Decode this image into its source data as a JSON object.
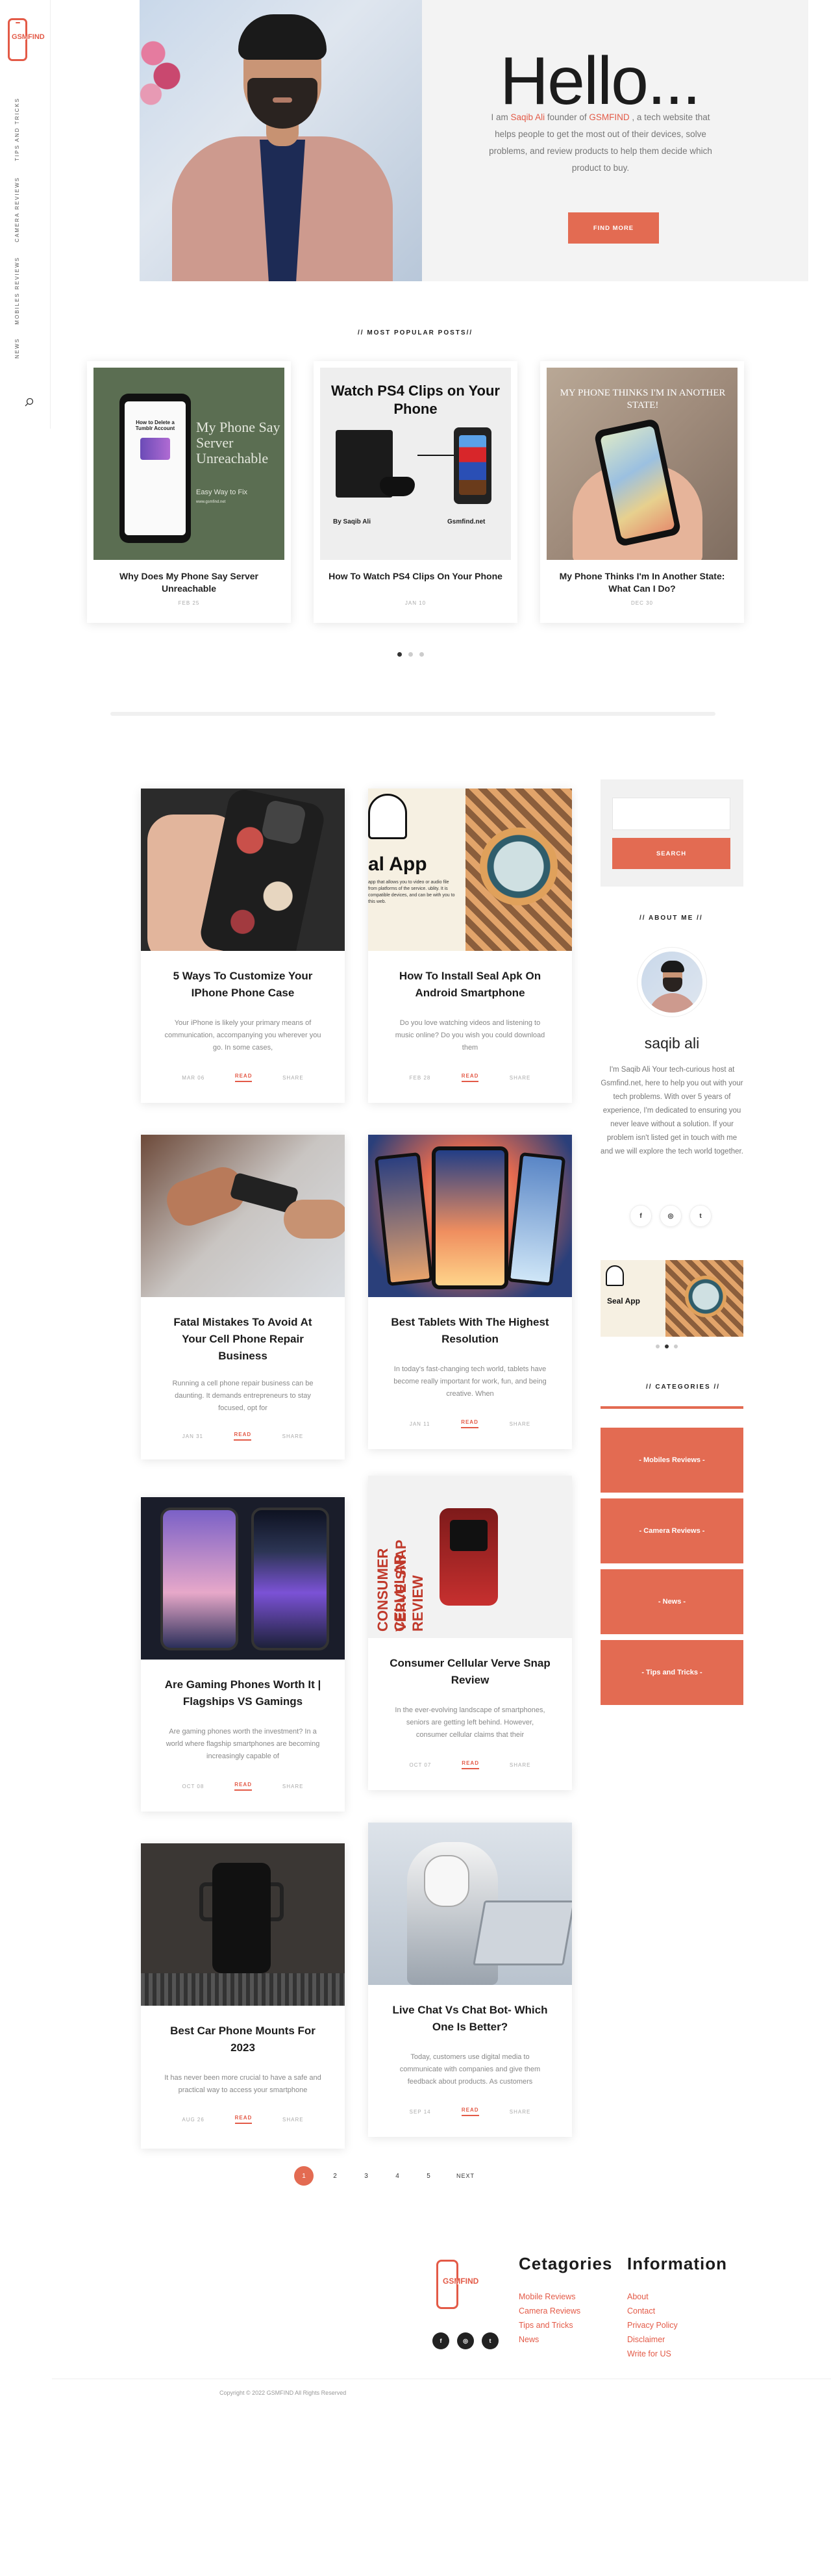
{
  "logo": {
    "text": "GSMFIND"
  },
  "sidenav": {
    "items": [
      "TIPS AND TRICKS",
      "CAMERA REVIEWS",
      "MOBILES REVIEWS",
      "NEWS"
    ]
  },
  "hero": {
    "title": "Hello...",
    "text_before": "I am ",
    "author": "Saqib Ali",
    "text_mid": " founder of ",
    "site": "GSMFIND",
    "text_after": " , a tech website that helps people to get the most out of their devices, solve problems, and review products to help them decide which product to buy.",
    "button": "FIND MORE"
  },
  "popular": {
    "title": "// MOST POPULAR POSTS//",
    "posts": [
      {
        "title": "Why Does My Phone Say Server Unreachable",
        "date": "FEB 25",
        "img_title": "My Phone Say Server Unreachable",
        "img_sub": "Easy Way to Fix",
        "img_screen": "How to Delete a Tumblr Account",
        "img_url": "www.gsmfind.net"
      },
      {
        "title": "How To Watch PS4 Clips On Your Phone",
        "date": "JAN 10",
        "img_title": "Watch PS4 Clips on Your Phone",
        "img_by": "By Saqib Ali",
        "img_site": "Gsmfind.net"
      },
      {
        "title": "My Phone Thinks I'm In Another State: What Can I Do?",
        "date": "DEC 30",
        "img_title": "MY PHONE THINKS I'M IN ANOTHER STATE!"
      }
    ]
  },
  "posts": [
    {
      "title": "5 Ways To Customize Your IPhone Phone Case",
      "excerpt": "Your iPhone is likely your primary means of communication, accompanying you wherever you go. In some cases,",
      "date": "MAR 06",
      "read": "READ",
      "share": "SHARE"
    },
    {
      "title": "How To Install Seal Apk On Android Smartphone",
      "excerpt": "Do you love watching videos and listening to music online? Do you wish you could download them",
      "date": "FEB 28",
      "read": "READ",
      "share": "SHARE",
      "img_label": "al App",
      "img_small": "app that allows you to video or audio file from platforms of the service. ublity. It is compatible devices, and can be with you to this web."
    },
    {
      "title": "Fatal Mistakes To Avoid At Your Cell Phone Repair Business",
      "excerpt": "Running a cell phone repair business can be daunting. It demands entrepreneurs to stay focused, opt for",
      "date": "JAN 31",
      "read": "READ",
      "share": "SHARE"
    },
    {
      "title": "Best Tablets With The Highest Resolution",
      "excerpt": "In today's fast-changing tech world, tablets have become really important for work, fun, and being creative. When",
      "date": "JAN 11",
      "read": "READ",
      "share": "SHARE"
    },
    {
      "title": "Are Gaming Phones Worth It | Flagships VS Gamings",
      "excerpt": "Are gaming phones worth the investment? In a world where flagship smartphones are becoming increasingly capable of",
      "date": "OCT 08",
      "read": "READ",
      "share": "SHARE"
    },
    {
      "title": "Consumer Cellular Verve Snap Review",
      "excerpt": "In the ever-evolving landscape of smartphones, seniors are getting left behind. However, consumer cellular claims that their",
      "date": "OCT 07",
      "read": "READ",
      "share": "SHARE",
      "img_v1": "CONSUMER CELLULAR",
      "img_v2": "VERVE SNAP REVIEW"
    },
    {
      "title": "Best Car Phone Mounts For 2023",
      "excerpt": "It has never been more crucial to have a safe and practical way to access your smartphone",
      "date": "AUG 26",
      "read": "READ",
      "share": "SHARE"
    },
    {
      "title": "Live Chat Vs Chat Bot- Which One Is Better?",
      "excerpt": "Today, customers use digital media to communicate with companies and give them feedback about products. As customers",
      "date": "SEP 14",
      "read": "READ",
      "share": "SHARE"
    }
  ],
  "sidebar": {
    "search_placeholder": "",
    "search_button": "SEARCH",
    "about_title": "// ABOUT ME //",
    "name": "saqib ali",
    "about": "I'm Saqib Ali Your tech-curious host at Gsmfind.net, here to help you out with your tech problems. With over 5 years of experience, I'm dedicated to ensuring you never leave without a solution. If your problem isn't listed get in touch with me and we will explore the tech world together.",
    "social": [
      "f",
      "◎",
      "t"
    ],
    "widget_label": "Seal App",
    "categories_title": "// CATEGORIES //",
    "categories": [
      "- Mobiles Reviews -",
      "- Camera Reviews -",
      "- News -",
      "- Tips and Tricks -"
    ]
  },
  "pagination": {
    "pages": [
      "1",
      "2",
      "3",
      "4",
      "5"
    ],
    "next": "NEXT"
  },
  "footer": {
    "cat_head": "Cetagories",
    "info_head": "Information",
    "cats": [
      "Mobile Reviews",
      "Camera Reviews",
      "Tips and Tricks",
      "News"
    ],
    "info": [
      "About",
      "Contact",
      "Privacy Policy",
      "Disclaimer",
      "Write for US"
    ],
    "social": [
      "f",
      "◎",
      "t"
    ],
    "copyright": "Copyright © 2022 GSMFIND All Rights Reserved"
  },
  "colors": {
    "accent": "#e36b52",
    "text": "#222222",
    "muted": "#888888"
  }
}
